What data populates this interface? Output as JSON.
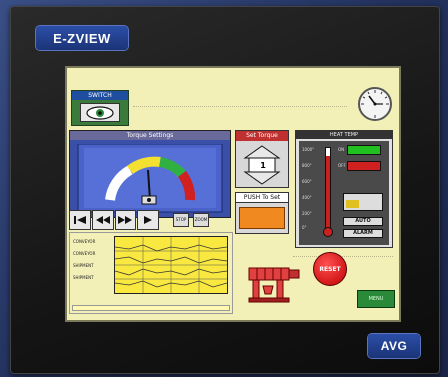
{
  "brand": {
    "label": "E-ZVIEW"
  },
  "model": {
    "label": "AVG"
  },
  "switch_panel": {
    "title": "SWITCH"
  },
  "torque": {
    "title": "Torque Settings"
  },
  "set_torque": {
    "title": "Set Torque",
    "value": "1"
  },
  "push_to_set": {
    "title": "PUSH To Set"
  },
  "status": {
    "title": "HEAT TEMP",
    "scale": [
      "1000°",
      "800°",
      "600°",
      "400°",
      "200°",
      "0°"
    ],
    "temperature_fraction": 0.9,
    "lamps": [
      {
        "label": "ON",
        "color": "#20c020"
      },
      {
        "label": "OFF",
        "color": "#d02020"
      }
    ],
    "level_fraction": 0.35,
    "buttons": {
      "auto": "AUTO",
      "alarm": "ALARM"
    }
  },
  "nav": {
    "small_buttons": [
      "STOP",
      "ZOOM"
    ]
  },
  "trend": {
    "labels": [
      "CONVEYOR",
      "CONVEYOR",
      "SHIPMENT",
      "SHIPMENT"
    ]
  },
  "reset_button": {
    "label": "RESET"
  },
  "menu_button": {
    "label": "MENU"
  },
  "colors": {
    "screen_bg": "#f2f0b6",
    "accent_blue": "#3a4fa8",
    "badge_blue": "#1b3477",
    "alarm_red": "#c00000",
    "ok_green": "#2a8a3a",
    "trend_yellow": "#f8e840"
  }
}
